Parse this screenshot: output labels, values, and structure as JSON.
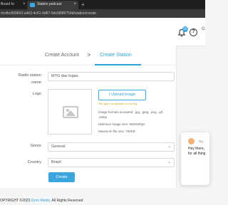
{
  "browser": {
    "tab1_title": "Board fo",
    "tab2_title": "Station podcast",
    "url": "dcsfbc509603-a463-4c61-9d87-5dc589f0754d/station/create",
    "colors": {
      "tab_bg": "#1f1f1f",
      "active_tab": "#3b3b3b"
    }
  },
  "header": {
    "notification_count": "10",
    "help_icon": "?",
    "user_initial": "G"
  },
  "steps": {
    "step1": "Create Account",
    "separator": ">",
    "step2": "Create Station"
  },
  "form": {
    "station_name_label_1": "Radio station",
    "station_name_label_2": "name",
    "station_name_value": "MTG das fugas",
    "logo_label": "Logo",
    "upload_button": "Upload image",
    "upload_warning": "File type not allowed or too big",
    "formats_note_1": "Image formats accepted: .jpg, .jpeg, .png, .gif,",
    "formats_note_2": ".webp",
    "min_size_note": "Minimum image size: 500x500px",
    "max_size_note": "Maximum file size: 700KB",
    "genre_label": "Genre",
    "genre_value": "General",
    "country_label": "Country",
    "country_value": "Brazil",
    "create_button": "Create"
  },
  "chat": {
    "name": "Ng",
    "line1": "Hey there,",
    "line2": "for all thing"
  },
  "footer": {
    "prefix": "OPYRIGHT ©2023",
    "brand": "Zeno Media.",
    "suffix": "All Rights Reserved"
  },
  "accent_color": "#3aa6dd"
}
